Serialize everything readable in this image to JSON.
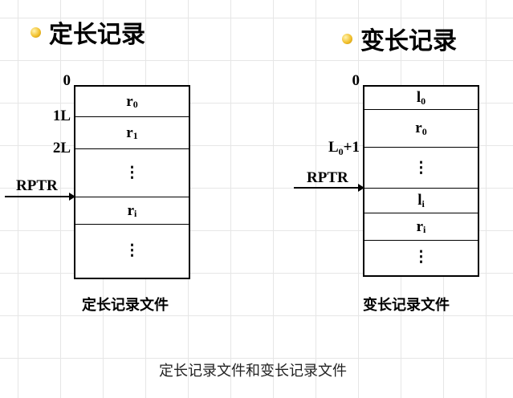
{
  "left": {
    "heading": "定长记录",
    "cells": [
      {
        "main": "r",
        "sub": "0"
      },
      {
        "main": "r",
        "sub": "1"
      },
      {
        "main": "⋮",
        "sub": ""
      },
      {
        "main": "r",
        "sub": "i"
      },
      {
        "main": "⋮",
        "sub": ""
      }
    ],
    "offset_labels": [
      "0",
      "1L",
      "2L"
    ],
    "pointer_label": "RPTR",
    "caption": "定长记录文件"
  },
  "right": {
    "heading": "变长记录",
    "cells": [
      {
        "main": "l",
        "sub": "0"
      },
      {
        "main": "r",
        "sub": "0"
      },
      {
        "main": "⋮",
        "sub": ""
      },
      {
        "main": "l",
        "sub": "i"
      },
      {
        "main": "r",
        "sub": "i"
      },
      {
        "main": "⋮",
        "sub": ""
      }
    ],
    "offset_labels": [
      {
        "main": "0",
        "sub": "",
        "rest": ""
      },
      {
        "main": "L",
        "sub": "0",
        "rest": "+1"
      }
    ],
    "pointer_label": "RPTR",
    "caption": "变长记录文件"
  },
  "footer_caption": "定长记录文件和变长记录文件",
  "colors": {
    "bullet": "#f2c12e",
    "grid": "#e6e6e6",
    "line": "#000000"
  },
  "icons": {
    "bullet": "bullet-icon",
    "arrow": "arrow-icon"
  }
}
